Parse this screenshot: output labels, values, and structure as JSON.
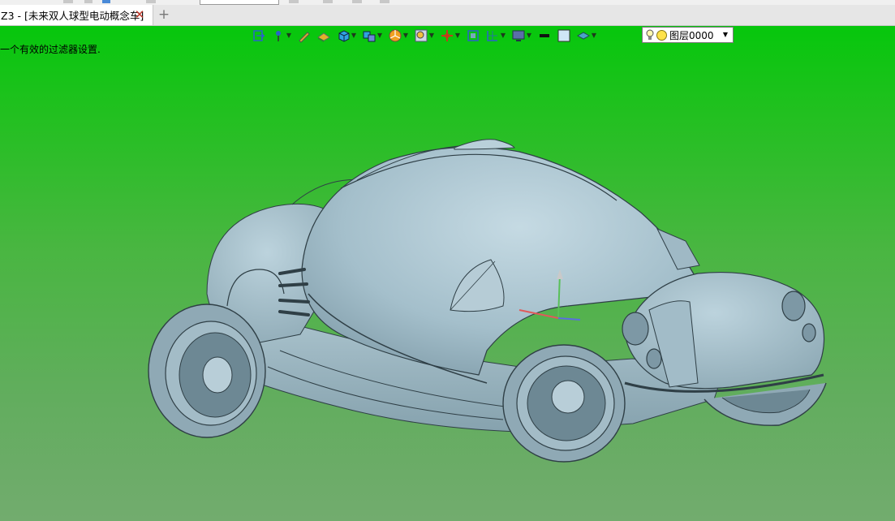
{
  "tab": {
    "title": "Z3 - [未来双人球型电动概念车]"
  },
  "viewport": {
    "prompt": "一个有效的过滤器设置."
  },
  "toolbar": {
    "tools": [
      {
        "name": "exit-icon",
        "color": "#2a63c9",
        "dropdown": false
      },
      {
        "name": "pin-icon",
        "color": "#2a63c9",
        "dropdown": true
      },
      {
        "name": "pencil-icon",
        "color": "#e1b22a",
        "dropdown": false
      },
      {
        "name": "shaded-icon",
        "color": "#e1b22a",
        "dropdown": false
      },
      {
        "name": "cube-icon",
        "color": "#2fa3e0",
        "dropdown": true
      },
      {
        "name": "views-icon",
        "color": "#2fa3e0",
        "dropdown": true
      },
      {
        "name": "pie-icon",
        "color": "#f0a020",
        "dropdown": true
      },
      {
        "name": "zoom-icon",
        "color": "#f0c040",
        "dropdown": true
      },
      {
        "name": "origin-icon",
        "color": "#c63a1c",
        "dropdown": true
      },
      {
        "name": "fit-icon",
        "color": "#2a63c9",
        "dropdown": false
      },
      {
        "name": "grid-icon",
        "color": "#2a63c9",
        "dropdown": true
      },
      {
        "name": "monitor-icon",
        "color": "#5a6ea8",
        "dropdown": true
      },
      {
        "name": "line-color-icon",
        "color": "#111111",
        "dropdown": false
      },
      {
        "name": "face-color-icon",
        "color": "#cfe6f7",
        "dropdown": false
      },
      {
        "name": "layer-plane-icon",
        "color": "#4aa3c8",
        "dropdown": true
      }
    ],
    "layer": {
      "value": "图层0000"
    }
  },
  "colors": {
    "background_top": "#06c70c",
    "background_bottom": "#72ac6e",
    "model": "#a4bfcb"
  }
}
